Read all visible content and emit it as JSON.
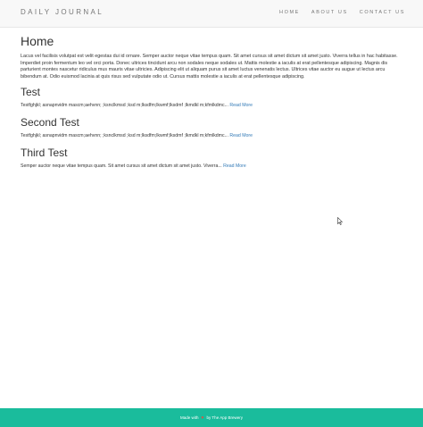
{
  "navbar": {
    "brand": "DAILY JOURNAL",
    "links": [
      {
        "label": "HOME"
      },
      {
        "label": "ABOUT US"
      },
      {
        "label": "CONTACT US"
      }
    ]
  },
  "main": {
    "title": "Home",
    "intro": "Lacus vel facilisis volutpat est velit egestas dui id ornare. Semper auctor neque vitae tempus quam. Sit amet cursus sit amet dictum sit amet justo. Viverra tellus in hac habitasse. Imperdiet proin fermentum leo vel orci porta. Donec ultrices tincidunt arcu non sodales neque sodales ut. Mattis molestie a iaculis at erat pellentesque adipiscing. Magnis dis parturient montes nascetur ridiculus mus mauris vitae ultricies. Adipiscing elit ut aliquam purus sit amet luctus venenatis lectus. Ultrices vitae auctor eu augue ut lectus arcu bibendum at. Odio euismod lacinia at quis risus sed vulputate odio ut. Cursus mattis molestie a iaculis at erat pellentesque adipiscing.",
    "posts": [
      {
        "title": "Test",
        "excerpt": "Testfghjkl; asnapnvidm mascm;aehvnn; ;ksnclkmsd ;ksd m;lksdfm;lkwmf;lksdmf ;lkmdkl m;kfmlkdmc",
        "read_more": "Read More"
      },
      {
        "title": "Second Test",
        "excerpt": "Testfghjkl; asnapnvidm mascm;aehvnn; ;ksnclkmsd ;ksd m;lksdfm;lkwmf;lksdmf ;lkmdkl m;kfmlkdmc",
        "read_more": "Read More"
      },
      {
        "title": "Third Test",
        "excerpt": "Semper auctor neque vitae tempus quam. Sit amet cursus sit amet dictum sit amet justo. Viverra",
        "read_more": "Read More"
      }
    ]
  },
  "footer": {
    "made_with": "Made with",
    "heart_icon": "heart-icon",
    "by": "by The App Brewery",
    "heart_color": "#e74c3c",
    "background_color": "#1abc9c"
  }
}
